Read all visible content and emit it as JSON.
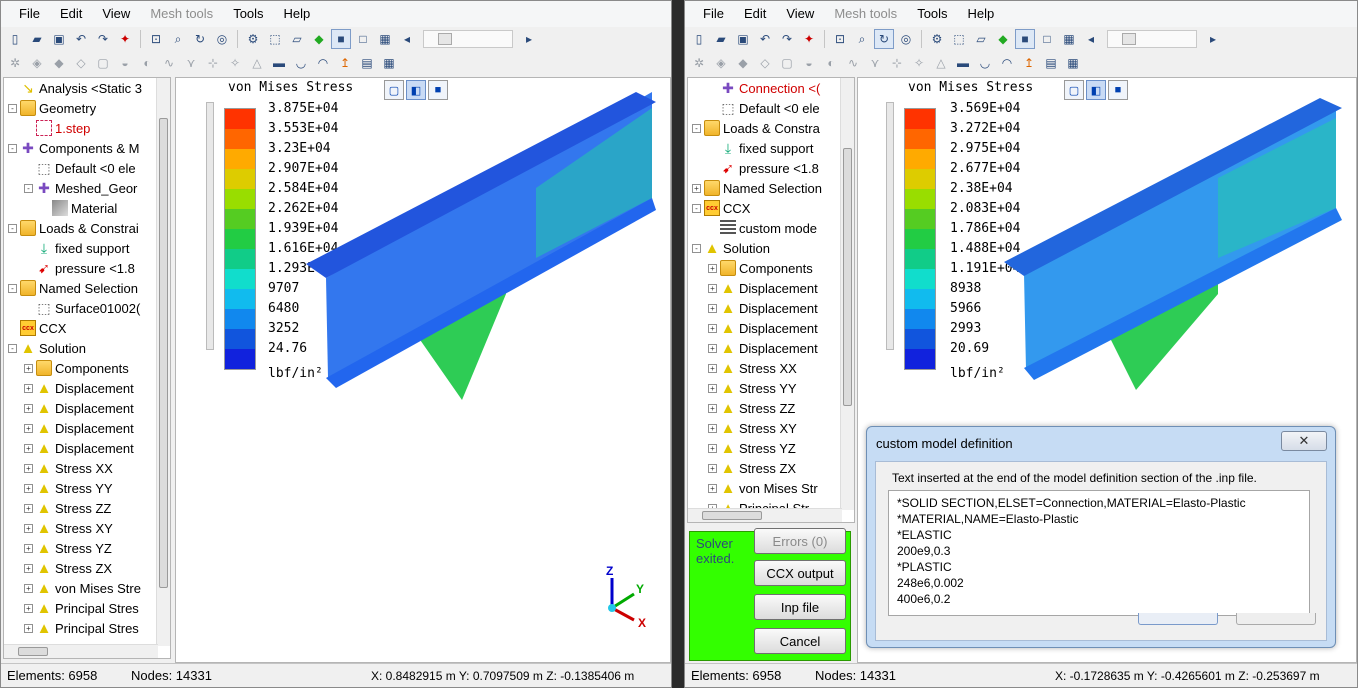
{
  "menus": [
    "File",
    "Edit",
    "View",
    "Mesh tools",
    "Tools",
    "Help"
  ],
  "left": {
    "tree": [
      {
        "indent": 1,
        "exp": "",
        "icon": "analysis",
        "label": "Analysis <Static 3"
      },
      {
        "indent": 1,
        "exp": "-",
        "icon": "folder",
        "label": "Geometry"
      },
      {
        "indent": 2,
        "exp": "",
        "icon": "step",
        "label": "1.step",
        "red": true
      },
      {
        "indent": 1,
        "exp": "-",
        "icon": "comp",
        "label": "Components & M"
      },
      {
        "indent": 2,
        "exp": "",
        "icon": "cube",
        "label": "Default <0 ele"
      },
      {
        "indent": 2,
        "exp": "-",
        "icon": "comp",
        "label": "Meshed_Geor"
      },
      {
        "indent": 3,
        "exp": "",
        "icon": "mat",
        "label": "Material"
      },
      {
        "indent": 1,
        "exp": "-",
        "icon": "folder",
        "label": "Loads & Constrai"
      },
      {
        "indent": 2,
        "exp": "",
        "icon": "fixed",
        "label": "fixed support"
      },
      {
        "indent": 2,
        "exp": "",
        "icon": "press",
        "label": "pressure <1.8"
      },
      {
        "indent": 1,
        "exp": "-",
        "icon": "folder",
        "label": "Named Selection"
      },
      {
        "indent": 2,
        "exp": "",
        "icon": "cube",
        "label": "Surface01002("
      },
      {
        "indent": 1,
        "exp": "",
        "icon": "ccx",
        "label": "CCX"
      },
      {
        "indent": 1,
        "exp": "-",
        "icon": "tri",
        "label": "Solution"
      },
      {
        "indent": 2,
        "exp": "+",
        "icon": "folder",
        "label": "Components"
      },
      {
        "indent": 2,
        "exp": "+",
        "icon": "tri",
        "label": "Displacement"
      },
      {
        "indent": 2,
        "exp": "+",
        "icon": "tri",
        "label": "Displacement"
      },
      {
        "indent": 2,
        "exp": "+",
        "icon": "tri",
        "label": "Displacement"
      },
      {
        "indent": 2,
        "exp": "+",
        "icon": "tri",
        "label": "Displacement"
      },
      {
        "indent": 2,
        "exp": "+",
        "icon": "tri",
        "label": "Stress XX"
      },
      {
        "indent": 2,
        "exp": "+",
        "icon": "tri",
        "label": "Stress YY"
      },
      {
        "indent": 2,
        "exp": "+",
        "icon": "tri",
        "label": "Stress ZZ"
      },
      {
        "indent": 2,
        "exp": "+",
        "icon": "tri",
        "label": "Stress XY"
      },
      {
        "indent": 2,
        "exp": "+",
        "icon": "tri",
        "label": "Stress YZ"
      },
      {
        "indent": 2,
        "exp": "+",
        "icon": "tri",
        "label": "Stress ZX"
      },
      {
        "indent": 2,
        "exp": "+",
        "icon": "tri",
        "label": "von Mises Stre"
      },
      {
        "indent": 2,
        "exp": "+",
        "icon": "tri",
        "label": "Principal Stres"
      },
      {
        "indent": 2,
        "exp": "+",
        "icon": "tri",
        "label": "Principal Stres"
      }
    ],
    "legend_title": "von Mises Stress",
    "legend_values": [
      "3.875E+04",
      "3.553E+04",
      "3.23E+04",
      "2.907E+04",
      "2.584E+04",
      "2.262E+04",
      "1.939E+04",
      "1.616E+04",
      "1.293E+04",
      "9707",
      "6480",
      "3252",
      "24.76"
    ],
    "unit": "lbf/in²",
    "status_elements": "Elements:  6958",
    "status_nodes": "Nodes:  14331",
    "status_coords": "X: 0.8482915 m Y: 0.7097509 m Z: -0.1385406 m",
    "axis_z": "Z",
    "axis_y": "Y",
    "axis_x": "X"
  },
  "right": {
    "tree": [
      {
        "indent": 2,
        "exp": "",
        "icon": "comp",
        "label": "Connection <(",
        "red": true
      },
      {
        "indent": 2,
        "exp": "",
        "icon": "cube",
        "label": "Default <0 ele"
      },
      {
        "indent": 1,
        "exp": "-",
        "icon": "folder",
        "label": "Loads & Constra"
      },
      {
        "indent": 2,
        "exp": "",
        "icon": "fixed",
        "label": "fixed support"
      },
      {
        "indent": 2,
        "exp": "",
        "icon": "press",
        "label": "pressure <1.8"
      },
      {
        "indent": 1,
        "exp": "+",
        "icon": "folder",
        "label": "Named Selection"
      },
      {
        "indent": 1,
        "exp": "-",
        "icon": "ccx",
        "label": "CCX"
      },
      {
        "indent": 2,
        "exp": "",
        "icon": "custom",
        "label": "custom mode"
      },
      {
        "indent": 1,
        "exp": "-",
        "icon": "tri",
        "label": "Solution"
      },
      {
        "indent": 2,
        "exp": "+",
        "icon": "folder",
        "label": "Components"
      },
      {
        "indent": 2,
        "exp": "+",
        "icon": "tri",
        "label": "Displacement"
      },
      {
        "indent": 2,
        "exp": "+",
        "icon": "tri",
        "label": "Displacement"
      },
      {
        "indent": 2,
        "exp": "+",
        "icon": "tri",
        "label": "Displacement"
      },
      {
        "indent": 2,
        "exp": "+",
        "icon": "tri",
        "label": "Displacement"
      },
      {
        "indent": 2,
        "exp": "+",
        "icon": "tri",
        "label": "Stress XX"
      },
      {
        "indent": 2,
        "exp": "+",
        "icon": "tri",
        "label": "Stress YY"
      },
      {
        "indent": 2,
        "exp": "+",
        "icon": "tri",
        "label": "Stress ZZ"
      },
      {
        "indent": 2,
        "exp": "+",
        "icon": "tri",
        "label": "Stress XY"
      },
      {
        "indent": 2,
        "exp": "+",
        "icon": "tri",
        "label": "Stress YZ"
      },
      {
        "indent": 2,
        "exp": "+",
        "icon": "tri",
        "label": "Stress ZX"
      },
      {
        "indent": 2,
        "exp": "+",
        "icon": "tri",
        "label": "von Mises Str"
      },
      {
        "indent": 2,
        "exp": "+",
        "icon": "tri",
        "label": "Principal Str"
      }
    ],
    "legend_title": "von Mises Stress",
    "legend_values": [
      "3.569E+04",
      "3.272E+04",
      "2.975E+04",
      "2.677E+04",
      "2.38E+04",
      "2.083E+04",
      "1.786E+04",
      "1.488E+04",
      "1.191E+04",
      "8938",
      "5966",
      "2993",
      "20.69"
    ],
    "unit": "lbf/in²",
    "solver_status": "Solver exited.",
    "btn_errors": "Errors (0)",
    "btn_ccx_output": "CCX output",
    "btn_inp_file": "Inp file",
    "btn_cancel": "Cancel",
    "status_elements": "Elements:  6958",
    "status_nodes": "Nodes:  14331",
    "status_coords": "X: -0.1728635 m Y: -0.4265601 m Z: -0.253697 m"
  },
  "dialog": {
    "title": "custom model definition",
    "close": "✕",
    "description": "Text inserted at the end of the model definition section of the .inp file.",
    "text": "*SOLID SECTION,ELSET=Connection,MATERIAL=Elasto-Plastic\n*MATERIAL,NAME=Elasto-Plastic\n*ELASTIC\n200e9,0.3\n*PLASTIC\n248e6,0.002\n400e6,0.2"
  },
  "legend_colors": [
    "#ff3300",
    "#ff6600",
    "#ffaa00",
    "#ddcc00",
    "#99dd00",
    "#55cc22",
    "#22cc44",
    "#11cc88",
    "#11ddcc",
    "#11bbee",
    "#1188ee",
    "#1155dd",
    "#1122dd"
  ]
}
